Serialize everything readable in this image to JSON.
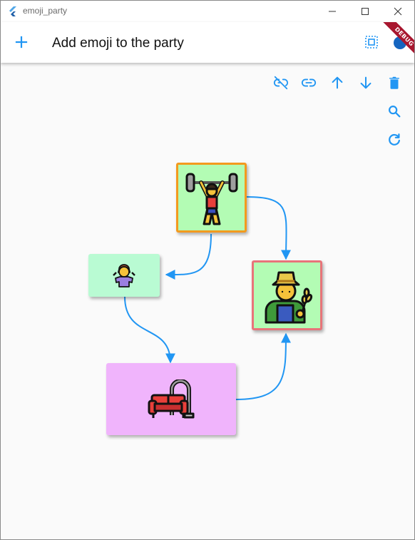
{
  "window": {
    "title": "emoji_party",
    "minimize_icon": "minimize-icon",
    "maximize_icon": "maximize-icon",
    "close_icon": "close-icon"
  },
  "appbar": {
    "title": "Add emoji to the party",
    "add_icon": "plus-icon",
    "select_all_icon": "select-all-icon",
    "debug_banner": "DEBUG"
  },
  "toolbar": {
    "unlink_icon": "link-off-icon",
    "link_icon": "link-icon",
    "move_up_icon": "arrow-up-icon",
    "move_down_icon": "arrow-down-icon",
    "delete_icon": "trash-icon",
    "search_icon": "search-icon",
    "refresh_icon": "refresh-icon"
  },
  "colors": {
    "accent": "#2196f3",
    "node_green": "#b3fcb4",
    "node_mint": "#b9fbd3",
    "node_pink": "#f0b4fc",
    "border_orange": "#f39a1e",
    "border_red": "#e8747a"
  },
  "nodes": [
    {
      "id": "weightlifter",
      "emoji": "🏋️",
      "icon": "weightlifter-emoji"
    },
    {
      "id": "shrug",
      "emoji": "🤷",
      "icon": "person-shrugging-emoji"
    },
    {
      "id": "farmer",
      "emoji": "🧑‍🌾",
      "icon": "farmer-emoji"
    },
    {
      "id": "couch",
      "emoji": "🛋️",
      "icon": "couch-emoji"
    }
  ]
}
